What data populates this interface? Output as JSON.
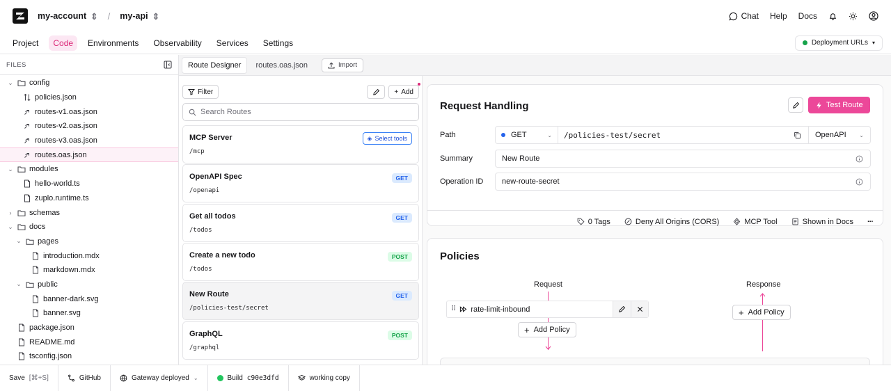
{
  "header": {
    "account": "my-account",
    "project": "my-api",
    "separator": "/",
    "chat": "Chat",
    "help": "Help",
    "docs": "Docs"
  },
  "nav": {
    "items": [
      "Project",
      "Code",
      "Environments",
      "Observability",
      "Services",
      "Settings"
    ],
    "active": "Code",
    "deployment_urls": "Deployment URLs"
  },
  "sidebar": {
    "title": "FILES",
    "tree": [
      {
        "label": "config",
        "type": "folder",
        "depth": 0,
        "expanded": true
      },
      {
        "label": "policies.json",
        "type": "policies",
        "depth": 1
      },
      {
        "label": "routes-v1.oas.json",
        "type": "route",
        "depth": 1
      },
      {
        "label": "routes-v2.oas.json",
        "type": "route",
        "depth": 1
      },
      {
        "label": "routes-v3.oas.json",
        "type": "route",
        "depth": 1
      },
      {
        "label": "routes.oas.json",
        "type": "route",
        "depth": 1,
        "selected": true
      },
      {
        "label": "modules",
        "type": "folder",
        "depth": 0,
        "expanded": true
      },
      {
        "label": "hello-world.ts",
        "type": "file",
        "depth": 1
      },
      {
        "label": "zuplo.runtime.ts",
        "type": "file",
        "depth": 1
      },
      {
        "label": "schemas",
        "type": "folder",
        "depth": 0,
        "expanded": false
      },
      {
        "label": "docs",
        "type": "folder",
        "depth": 0,
        "expanded": true
      },
      {
        "label": "pages",
        "type": "folder",
        "depth": 1,
        "expanded": true
      },
      {
        "label": "introduction.mdx",
        "type": "file",
        "depth": 2
      },
      {
        "label": "markdown.mdx",
        "type": "file",
        "depth": 2
      },
      {
        "label": "public",
        "type": "folder",
        "depth": 1,
        "expanded": true
      },
      {
        "label": "banner-dark.svg",
        "type": "file",
        "depth": 2
      },
      {
        "label": "banner.svg",
        "type": "file",
        "depth": 2
      },
      {
        "label": "package.json",
        "type": "file",
        "depth": 0
      },
      {
        "label": "README.md",
        "type": "file",
        "depth": 0
      },
      {
        "label": "tsconfig.json",
        "type": "file",
        "depth": 0
      }
    ]
  },
  "tabs": {
    "route_designer": "Route Designer",
    "routes_file": "routes.oas.json",
    "import": "Import"
  },
  "routes_panel": {
    "filter": "Filter",
    "add": "Add",
    "search_placeholder": "Search Routes",
    "routes": [
      {
        "name": "MCP Server",
        "path": "/mcp",
        "action": "Select tools"
      },
      {
        "name": "OpenAPI Spec",
        "path": "/openapi",
        "method": "GET"
      },
      {
        "name": "Get all todos",
        "path": "/todos",
        "method": "GET"
      },
      {
        "name": "Create a new todo",
        "path": "/todos",
        "method": "POST"
      },
      {
        "name": "New Route",
        "path": "/policies-test/secret",
        "method": "GET",
        "selected": true
      },
      {
        "name": "GraphQL",
        "path": "/graphql",
        "method": "POST"
      }
    ]
  },
  "request_handling": {
    "title": "Request Handling",
    "test_route": "Test Route",
    "path_label": "Path",
    "method": "GET",
    "path": "/policies-test/secret",
    "handler": "OpenAPI",
    "summary_label": "Summary",
    "summary": "New Route",
    "operation_label": "Operation ID",
    "operation_id": "new-route-secret",
    "meta": {
      "tags": "0 Tags",
      "cors": "Deny All Origins (CORS)",
      "mcp": "MCP Tool",
      "docs": "Shown in Docs",
      "more": "···"
    }
  },
  "policies": {
    "title": "Policies",
    "request_label": "Request",
    "response_label": "Response",
    "policy_name": "rate-limit-inbound",
    "add_policy": "Add Policy",
    "add_policy_response": "Add Policy"
  },
  "bottom": {
    "save": "Save",
    "save_shortcut": "[⌘+S]",
    "github": "GitHub",
    "gateway": "Gateway deployed",
    "build_label": "Build",
    "build_hash": "c90e3dfd",
    "working_copy": "working copy"
  },
  "colors": {
    "accent": "#ec4899",
    "get": "#2563eb",
    "post": "#16a34a"
  }
}
